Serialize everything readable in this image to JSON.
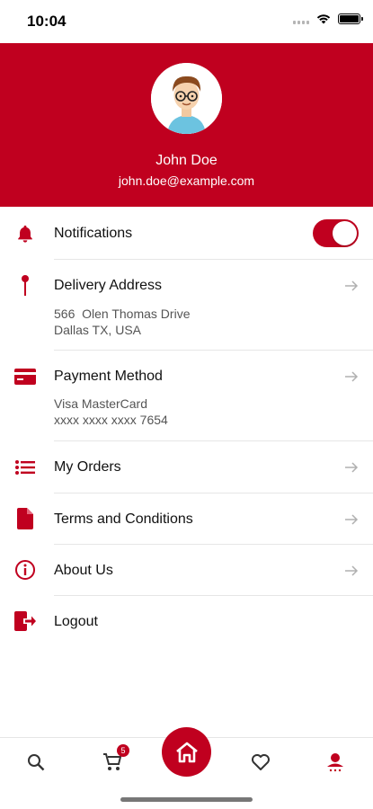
{
  "status_bar": {
    "time": "10:04"
  },
  "profile": {
    "name": "John Doe",
    "email": "john.doe@example.com"
  },
  "menu": {
    "notifications": {
      "label": "Notifications",
      "enabled": true
    },
    "delivery": {
      "label": "Delivery Address",
      "line1": "566  Olen Thomas Drive",
      "line2": "Dallas TX, USA"
    },
    "payment": {
      "label": "Payment Method",
      "line1": "Visa MasterCard",
      "line2": "xxxx xxxx xxxx 7654"
    },
    "orders": {
      "label": "My Orders"
    },
    "terms": {
      "label": "Terms and Conditions"
    },
    "about": {
      "label": "About Us"
    },
    "logout": {
      "label": "Logout"
    }
  },
  "tab_bar": {
    "cart_count": "5",
    "active_tab": "profile"
  },
  "colors": {
    "accent": "#c0001f",
    "arrow": "#b0b0b0",
    "divider": "#e6e6e6"
  }
}
